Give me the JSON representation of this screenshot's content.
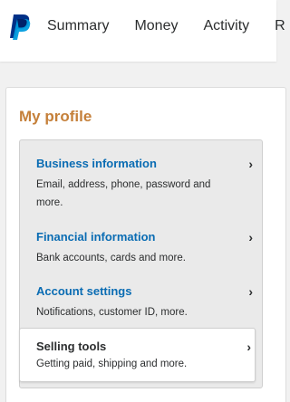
{
  "colors": {
    "brand_dark": "#003087",
    "brand_light": "#009cde",
    "title": "#c5803a",
    "link": "#0a6cb3"
  },
  "nav": {
    "items": [
      "Summary",
      "Money",
      "Activity",
      "R"
    ]
  },
  "profile": {
    "title": "My profile",
    "items": [
      {
        "label": "Business information",
        "description": "Email, address, phone, password and more.",
        "icon": "chevron-right-icon"
      },
      {
        "label": "Financial information",
        "description": "Bank accounts, cards and more.",
        "icon": "chevron-right-icon"
      },
      {
        "label": "Account settings",
        "description": "Notifications, customer ID, more.",
        "icon": "chevron-right-icon"
      },
      {
        "label": "Selling tools",
        "description": "Getting paid, shipping and more.",
        "icon": "chevron-right-icon",
        "selected": true
      }
    ],
    "chevron": "›"
  }
}
